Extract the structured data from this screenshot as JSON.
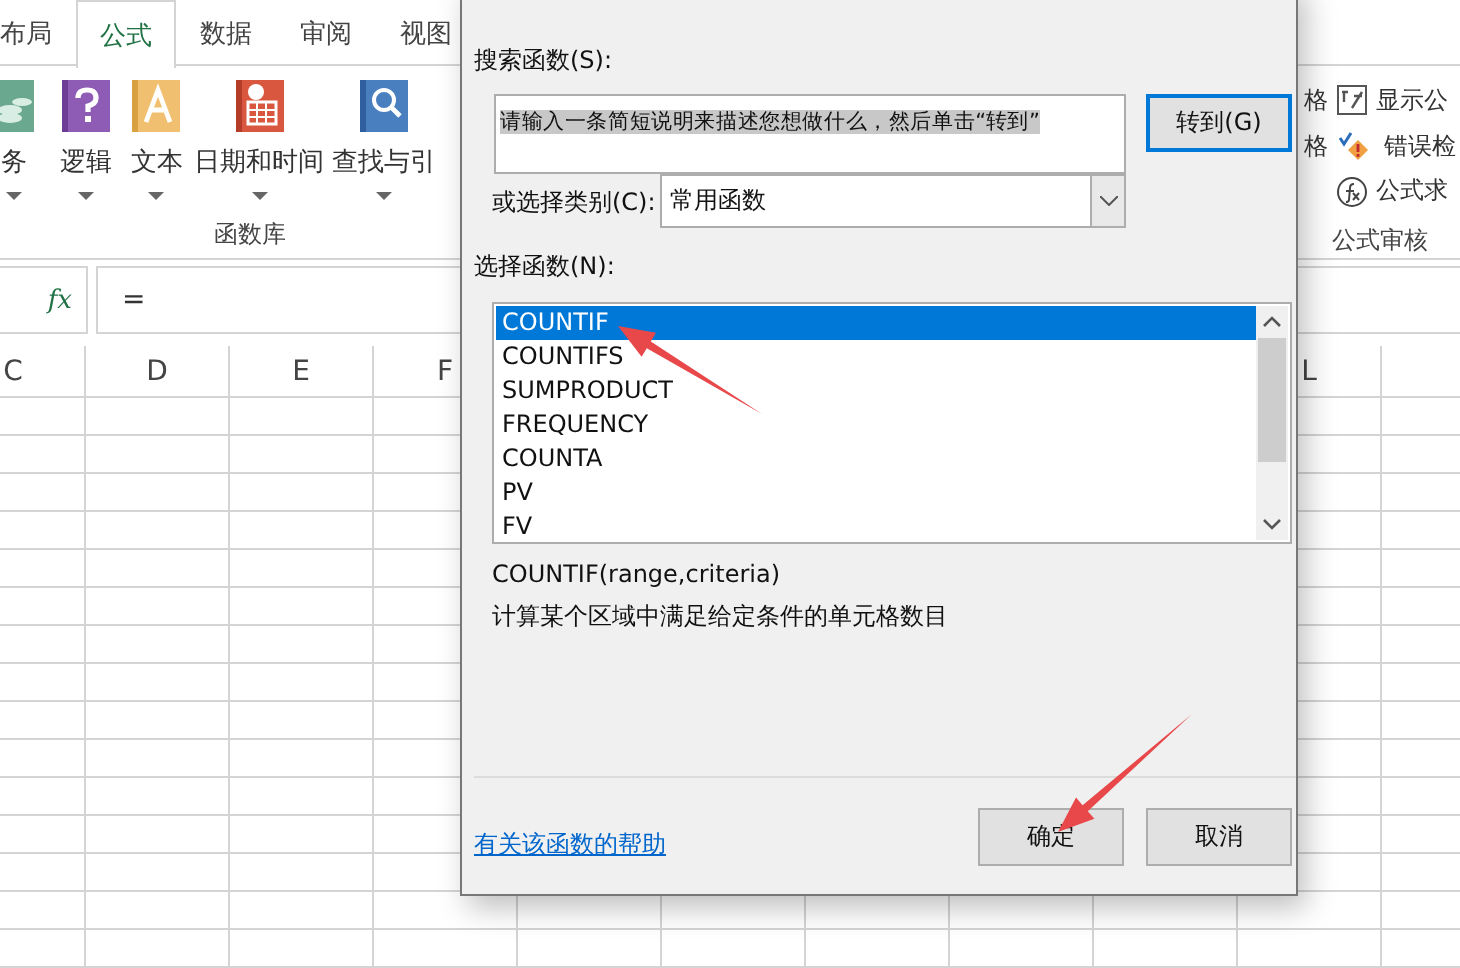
{
  "ribbon": {
    "tabs": [
      {
        "label": "布局",
        "selected": false
      },
      {
        "label": "公式",
        "selected": true
      },
      {
        "label": "数据",
        "selected": false
      },
      {
        "label": "审阅",
        "selected": false
      },
      {
        "label": "视图",
        "selected": false
      }
    ],
    "function_library": {
      "buttons": [
        {
          "label": "务",
          "kind": "finance"
        },
        {
          "label": "逻辑",
          "kind": "logic"
        },
        {
          "label": "文本",
          "kind": "text"
        },
        {
          "label": "日期和时间",
          "kind": "datetime"
        },
        {
          "label": "查找与引",
          "kind": "lookup"
        }
      ],
      "group_label": "函数库"
    },
    "formula_auditing": {
      "cut_labels": [
        "格",
        "格"
      ],
      "items": [
        {
          "label": "显示公",
          "kind": "show-formulas"
        },
        {
          "label": "错误检",
          "kind": "error-check"
        },
        {
          "label": "公式求",
          "kind": "evaluate"
        }
      ],
      "group_label": "公式审核"
    }
  },
  "formula_bar": {
    "fx": "fx",
    "value": "="
  },
  "sheet": {
    "left_columns": [
      "C",
      "D",
      "E",
      "F"
    ],
    "right_columns": [
      "L"
    ]
  },
  "dialog": {
    "search_label": "搜索函数(S):",
    "search_value": "请输入一条简短说明来描述您想做什么，然后单击“转到”",
    "search_text_selected": true,
    "go_button": "转到(G)",
    "category_label": "或选择类别(C):",
    "category_value": "常用函数",
    "function_list_label": "选择函数(N):",
    "functions": [
      {
        "name": "COUNTIF",
        "selected": true
      },
      {
        "name": "COUNTIFS",
        "selected": false
      },
      {
        "name": "SUMPRODUCT",
        "selected": false
      },
      {
        "name": "FREQUENCY",
        "selected": false
      },
      {
        "name": "COUNTA",
        "selected": false
      },
      {
        "name": "PV",
        "selected": false
      },
      {
        "name": "FV",
        "selected": false
      }
    ],
    "syntax": "COUNTIF(range,criteria)",
    "description": "计算某个区域中满足给定条件的单元格数目",
    "help_link": "有关该函数的帮助",
    "buttons": [
      {
        "label": "确定",
        "kind": "ok"
      },
      {
        "label": "取消",
        "kind": "cancel"
      }
    ]
  },
  "annotations": [
    {
      "kind": "arrow"
    },
    {
      "kind": "arrow"
    }
  ]
}
